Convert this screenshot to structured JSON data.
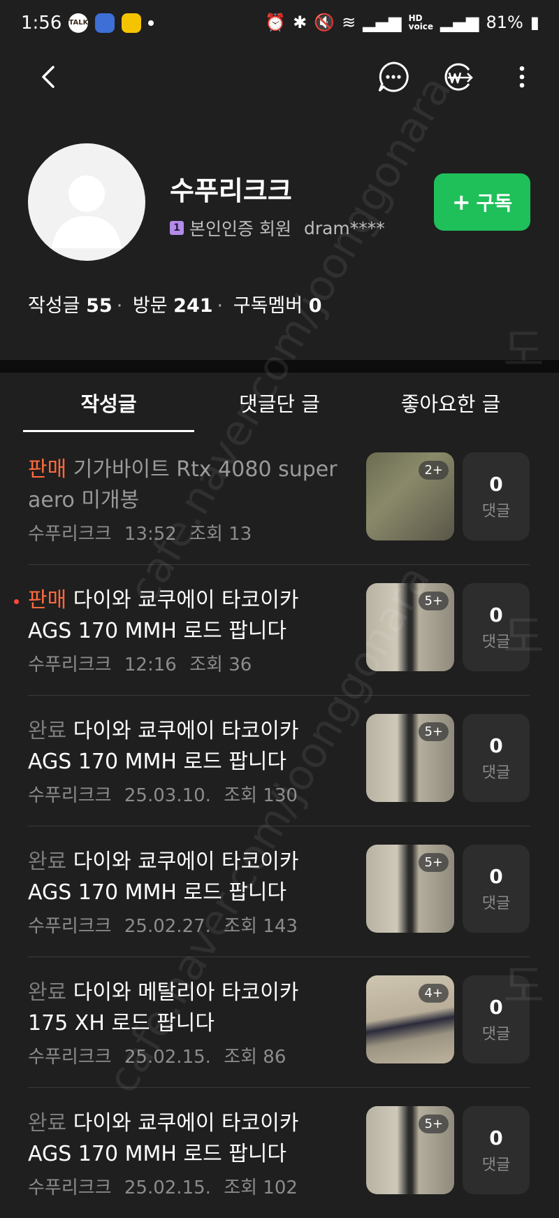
{
  "status_bar": {
    "time": "1:56",
    "talk_label": "TALK",
    "battery": "81%",
    "hd_label": "HD",
    "voice_label": "voice"
  },
  "profile": {
    "name": "수푸리크크",
    "member_badge": "1",
    "member_text": "본인인증 회원",
    "user_id": "dram****",
    "subscribe_label": "구독",
    "stats": {
      "posts_label": "작성글",
      "posts_value": "55",
      "visits_label": "방문",
      "visits_value": "241",
      "members_label": "구독멤버",
      "members_value": "0"
    }
  },
  "tabs": [
    {
      "label": "작성글",
      "active": true
    },
    {
      "label": "댓글단 글",
      "active": false
    },
    {
      "label": "좋아요한 글",
      "active": false
    }
  ],
  "posts": [
    {
      "tag": "판매",
      "tag_type": "sale",
      "title": "기가바이트 Rtx 4080 super aero 미개봉",
      "dim": true,
      "author": "수푸리크크",
      "date": "13:52",
      "views_label": "조회",
      "views": "13",
      "thumb_count": "2+",
      "comments": "0",
      "comments_label": "댓글",
      "new": false
    },
    {
      "tag": "판매",
      "tag_type": "sale",
      "title": "다이와 쿄쿠에이 타코이카 AGS 170 MMH 로드 팝니다",
      "dim": false,
      "author": "수푸리크크",
      "date": "12:16",
      "views_label": "조회",
      "views": "36",
      "thumb_count": "5+",
      "comments": "0",
      "comments_label": "댓글",
      "new": true
    },
    {
      "tag": "완료",
      "tag_type": "done",
      "title": "다이와 쿄쿠에이 타코이카 AGS 170 MMH 로드 팝니다",
      "dim": false,
      "author": "수푸리크크",
      "date": "25.03.10.",
      "views_label": "조회",
      "views": "130",
      "thumb_count": "5+",
      "comments": "0",
      "comments_label": "댓글",
      "new": false
    },
    {
      "tag": "완료",
      "tag_type": "done",
      "title": "다이와 쿄쿠에이 타코이카 AGS 170 MMH 로드 팝니다",
      "dim": false,
      "author": "수푸리크크",
      "date": "25.02.27.",
      "views_label": "조회",
      "views": "143",
      "thumb_count": "5+",
      "comments": "0",
      "comments_label": "댓글",
      "new": false
    },
    {
      "tag": "완료",
      "tag_type": "done",
      "title": "다이와 메탈리아 타코이카 175 XH 로드 팝니다",
      "dim": false,
      "author": "수푸리크크",
      "date": "25.02.15.",
      "views_label": "조회",
      "views": "86",
      "thumb_count": "4+",
      "comments": "0",
      "comments_label": "댓글",
      "new": false
    },
    {
      "tag": "완료",
      "tag_type": "done",
      "title": "다이와 쿄쿠에이 타코이카 AGS 170 MMH 로드 팝니다",
      "dim": false,
      "author": "수푸리크크",
      "date": "25.02.15.",
      "views_label": "조회",
      "views": "102",
      "thumb_count": "5+",
      "comments": "0",
      "comments_label": "댓글",
      "new": false
    }
  ],
  "watermark": "cafe.naver.com/joonggonara",
  "watermark_brand": "도"
}
